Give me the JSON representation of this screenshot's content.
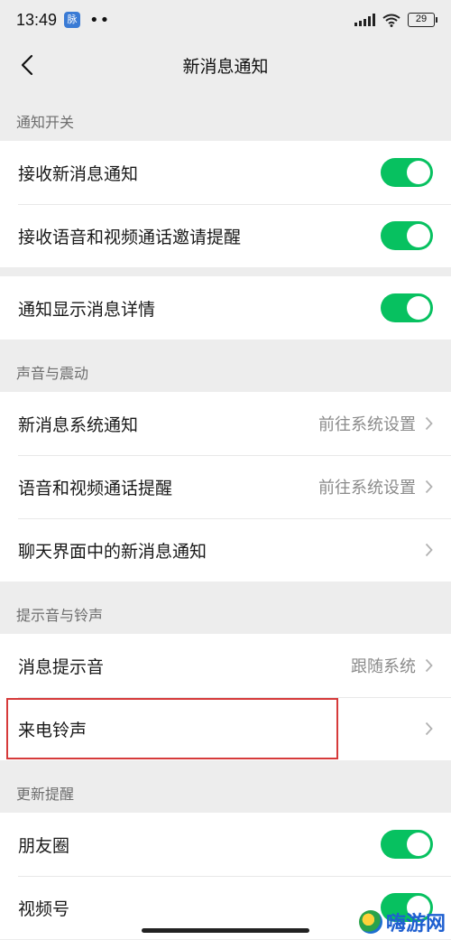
{
  "status_bar": {
    "time": "13:49",
    "badge": "脉",
    "dots": "••",
    "battery": "29"
  },
  "nav": {
    "title": "新消息通知"
  },
  "sections": {
    "notify_switch": {
      "header": "通知开关"
    },
    "sound_vibration": {
      "header": "声音与震动"
    },
    "tone_ringtone": {
      "header": "提示音与铃声"
    },
    "update_reminder": {
      "header": "更新提醒"
    }
  },
  "rows": {
    "receive_new_msg": {
      "label": "接收新消息通知",
      "toggle": true
    },
    "voice_video_invite": {
      "label": "接收语音和视频通话邀请提醒",
      "toggle": true
    },
    "show_msg_detail": {
      "label": "通知显示消息详情",
      "toggle": true
    },
    "sys_notification": {
      "label": "新消息系统通知",
      "value": "前往系统设置"
    },
    "call_reminder": {
      "label": "语音和视频通话提醒",
      "value": "前往系统设置"
    },
    "chat_notification": {
      "label": "聊天界面中的新消息通知"
    },
    "msg_tone": {
      "label": "消息提示音",
      "value": "跟随系统"
    },
    "ringtone": {
      "label": "来电铃声"
    },
    "moments": {
      "label": "朋友圈",
      "toggle": true
    },
    "channels": {
      "label": "视频号",
      "toggle": true
    }
  },
  "watermark": {
    "text": "嗨游网"
  },
  "colors": {
    "accent_green": "#07c160",
    "highlight_red": "#d63a3a",
    "background": "#ededed"
  }
}
